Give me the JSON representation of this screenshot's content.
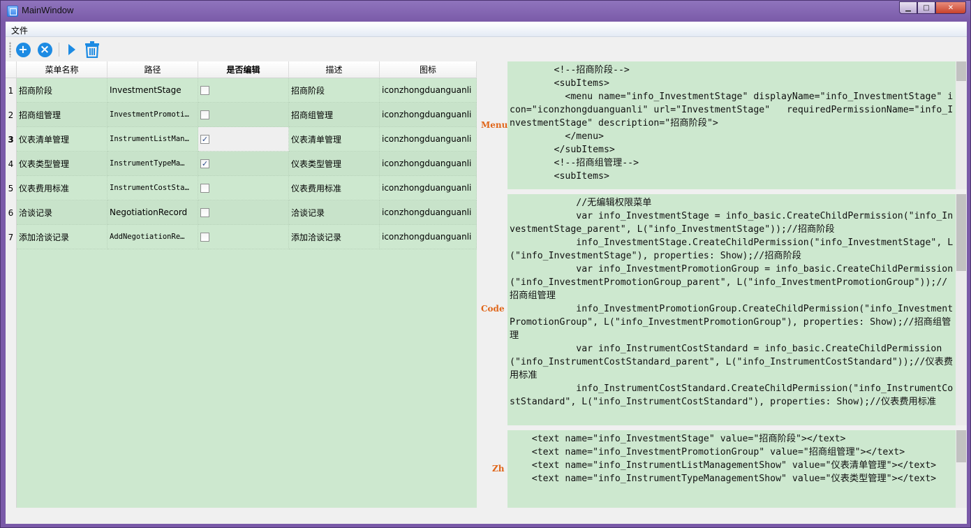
{
  "window": {
    "title": "MainWindow",
    "minimize_glyph": "▁",
    "maximize_glyph": "□",
    "close_glyph": "✕"
  },
  "menubar": {
    "file_label": "文件"
  },
  "toolbar": {
    "add_glyph": "+",
    "cancel_glyph": "×",
    "run_glyph": "▶",
    "delete_glyph": "🗑"
  },
  "table": {
    "headers": [
      "菜单名称",
      "路径",
      "是否编辑",
      "描述",
      "图标"
    ],
    "current_row": 3,
    "rows": [
      {
        "num": "1",
        "name": "招商阶段",
        "path": "InvestmentStage",
        "path_mono": false,
        "editable": false,
        "desc": "招商阶段",
        "icon": "iconzhongduanguanli"
      },
      {
        "num": "2",
        "name": "招商组管理",
        "path": "InvestmentPromoti…",
        "path_mono": true,
        "editable": false,
        "desc": "招商组管理",
        "icon": "iconzhongduanguanli"
      },
      {
        "num": "3",
        "name": "仪表清单管理",
        "path": "InstrumentListMan…",
        "path_mono": true,
        "editable": true,
        "desc": "仪表清单管理",
        "icon": "iconzhongduanguanli"
      },
      {
        "num": "4",
        "name": "仪表类型管理",
        "path": "InstrumentTypeMa…",
        "path_mono": true,
        "editable": true,
        "desc": "仪表类型管理",
        "icon": "iconzhongduanguanli"
      },
      {
        "num": "5",
        "name": "仪表费用标准",
        "path": "InstrumentCostSta…",
        "path_mono": true,
        "editable": false,
        "desc": "仪表费用标准",
        "icon": "iconzhongduanguanli"
      },
      {
        "num": "6",
        "name": "洽谈记录",
        "path": "NegotiationRecord",
        "path_mono": false,
        "editable": false,
        "desc": "洽谈记录",
        "icon": "iconzhongduanguanli"
      },
      {
        "num": "7",
        "name": "添加洽谈记录",
        "path": "AddNegotiationRe…",
        "path_mono": true,
        "editable": false,
        "desc": "添加洽谈记录",
        "icon": "iconzhongduanguanli"
      }
    ]
  },
  "panes": {
    "menu": {
      "label": "Menu",
      "text": "        <!--招商阶段-->\n        <subItems>\n          <menu name=\"info_InvestmentStage\" displayName=\"info_InvestmentStage\" icon=\"iconzhongduanguanli\" url=\"InvestmentStage\"   requiredPermissionName=\"info_InvestmentStage\" description=\"招商阶段\">\n          </menu>\n        </subItems>\n        <!--招商组管理-->\n        <subItems>"
    },
    "code": {
      "label": "Code",
      "text": "            //无编辑权限菜单\n            var info_InvestmentStage = info_basic.CreateChildPermission(\"info_InvestmentStage_parent\", L(\"info_InvestmentStage\"));//招商阶段\n            info_InvestmentStage.CreateChildPermission(\"info_InvestmentStage\", L(\"info_InvestmentStage\"), properties: Show);//招商阶段\n            var info_InvestmentPromotionGroup = info_basic.CreateChildPermission(\"info_InvestmentPromotionGroup_parent\", L(\"info_InvestmentPromotionGroup\"));//招商组管理\n            info_InvestmentPromotionGroup.CreateChildPermission(\"info_InvestmentPromotionGroup\", L(\"info_InvestmentPromotionGroup\"), properties: Show);//招商组管理\n            var info_InstrumentCostStandard = info_basic.CreateChildPermission(\"info_InstrumentCostStandard_parent\", L(\"info_InstrumentCostStandard\"));//仪表费用标准\n            info_InstrumentCostStandard.CreateChildPermission(\"info_InstrumentCostStandard\", L(\"info_InstrumentCostStandard\"), properties: Show);//仪表费用标准"
    },
    "zh": {
      "label": "Zh",
      "text": "    <text name=\"info_InvestmentStage\" value=\"招商阶段\"></text>\n    <text name=\"info_InvestmentPromotionGroup\" value=\"招商组管理\"></text>\n    <text name=\"info_InstrumentListManagementShow\" value=\"仪表清单管理\"></text>\n    <text name=\"info_InstrumentTypeManagementShow\" value=\"仪表类型管理\"></text>"
    }
  }
}
